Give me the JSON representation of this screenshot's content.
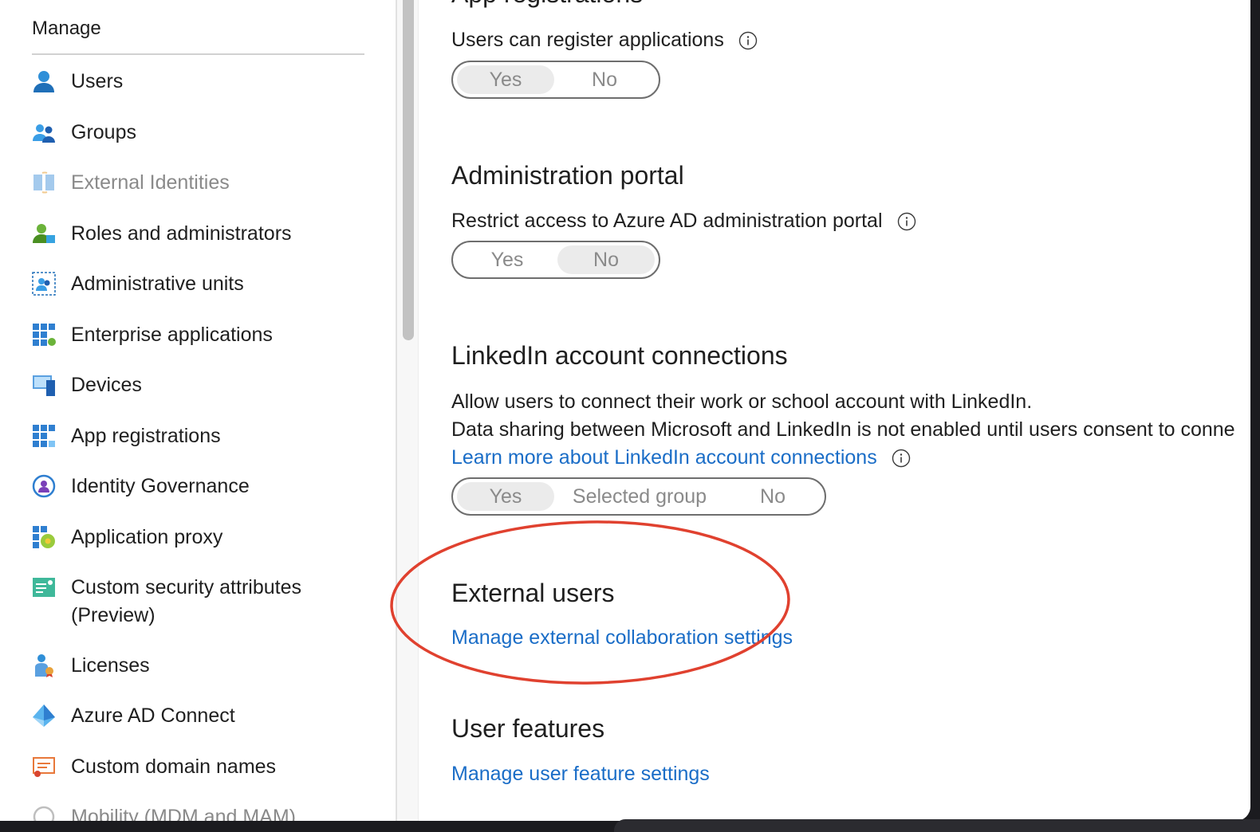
{
  "sidebar": {
    "heading": "Manage",
    "items": [
      {
        "label": "Users",
        "icon": "user-icon"
      },
      {
        "label": "Groups",
        "icon": "group-icon"
      },
      {
        "label": "External Identities",
        "icon": "external-identities-icon"
      },
      {
        "label": "Roles and administrators",
        "icon": "roles-icon"
      },
      {
        "label": "Administrative units",
        "icon": "administrative-units-icon"
      },
      {
        "label": "Enterprise applications",
        "icon": "enterprise-apps-icon"
      },
      {
        "label": "Devices",
        "icon": "devices-icon"
      },
      {
        "label": "App registrations",
        "icon": "app-registrations-icon"
      },
      {
        "label": "Identity Governance",
        "icon": "identity-governance-icon"
      },
      {
        "label": "Application proxy",
        "icon": "application-proxy-icon"
      },
      {
        "label": "Custom security attributes",
        "label2": "(Preview)",
        "icon": "custom-security-attributes-icon"
      },
      {
        "label": "Licenses",
        "icon": "licenses-icon"
      },
      {
        "label": "Azure AD Connect",
        "icon": "azure-ad-connect-icon"
      },
      {
        "label": "Custom domain names",
        "icon": "custom-domain-icon"
      },
      {
        "label": "Mobility (MDM and MAM)",
        "icon": "mobility-icon"
      }
    ]
  },
  "content": {
    "app_registrations": {
      "title": "App registrations",
      "setting_label": "Users can register applications",
      "options": [
        "Yes",
        "No"
      ],
      "selected": "Yes"
    },
    "admin_portal": {
      "title": "Administration portal",
      "setting_label": "Restrict access to Azure AD administration portal",
      "options": [
        "Yes",
        "No"
      ],
      "selected": "No"
    },
    "linkedin": {
      "title": "LinkedIn account connections",
      "line1": "Allow users to connect their work or school account with LinkedIn.",
      "line2": "Data sharing between Microsoft and LinkedIn is not enabled until users consent to conne",
      "learn_more": "Learn more about LinkedIn account connections",
      "options": [
        "Yes",
        "Selected group",
        "No"
      ],
      "selected": "Yes"
    },
    "external_users": {
      "title": "External users",
      "link": "Manage external collaboration settings"
    },
    "user_features": {
      "title": "User features",
      "link": "Manage user feature settings"
    }
  },
  "colors": {
    "link": "#1a6dc7",
    "highlight": "#e0412f",
    "toggle_selected_bg": "#ebebeb"
  }
}
